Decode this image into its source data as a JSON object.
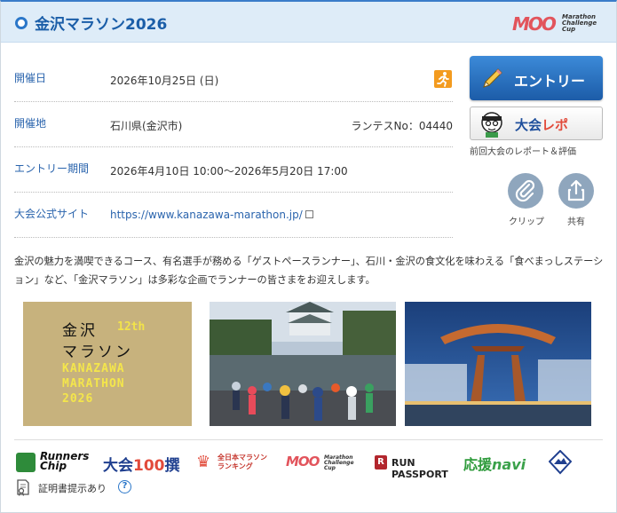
{
  "header": {
    "title": "金沢マラソン2026",
    "logo_text": "Marathon Challenge Cup",
    "logo_mark": "MOO"
  },
  "info_rows": [
    {
      "label": "開催日",
      "value": "2026年10月25日 (日)"
    },
    {
      "label": "開催地",
      "value": "石川県(金沢市)",
      "extra": "ランテスNo：04440"
    },
    {
      "label": "エントリー期間",
      "value": "2026年4月10日 10:00〜2026年5月20日 17:00"
    },
    {
      "label": "大会公式サイト",
      "value": "https://www.kanazawa-marathon.jp/"
    }
  ],
  "actions": {
    "entry_label": "エントリー",
    "report_label_a": "大会",
    "report_label_b": "レポ",
    "report_caption": "前回大会のレポート＆評価",
    "clip_label": "クリップ",
    "share_label": "共有"
  },
  "description": "金沢の魅力を満喫できるコース、有名選手が務める「ゲストペースランナー」、石川・金沢の食文化を味わえる「食べまっしステーション」など、「金沢マラソン」は多彩な企画でランナーの皆さまをお迎えします。",
  "poster": {
    "line1": "金沢",
    "line2": "マラソン",
    "edition": "12th",
    "line3": "KANAZAWA",
    "line4": "MARATHON",
    "line5": "2026"
  },
  "badges": {
    "runners_chip_a": "Runners",
    "runners_chip_b": "Chip",
    "taikai100_a": "大会",
    "taikai100_num": "100",
    "taikai100_b": "撰",
    "zenkoku_a": "全日本マラソン",
    "zenkoku_b": "ランキング",
    "moo_mark": "MOO",
    "moo_text": "Marathon Challenge Cup",
    "runpass_r": "R",
    "runpass": "RUN PASSPORT",
    "ouen_a": "応援",
    "ouen_b": "navi"
  },
  "certificate": {
    "text": "証明書提示あり",
    "help": "?"
  },
  "colors": {
    "accent": "#2b77c9",
    "header_bg": "#deecf8",
    "entry_btn": "#2a70c0",
    "label": "#2a64ad"
  }
}
